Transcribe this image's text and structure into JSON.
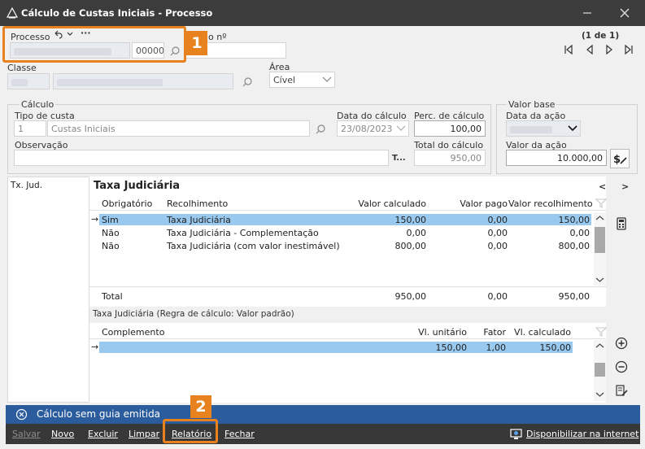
{
  "window": {
    "title": "Cálculo de Custas Iniciais - Processo"
  },
  "header": {
    "processo_label": "Processo",
    "processo_value": "00000",
    "calculo_no_label": "o nº",
    "pagination": "(1 de 1)",
    "classe_label": "Classe",
    "area_label": "Área",
    "area_value": "Cível"
  },
  "calculo": {
    "group_label": "Cálculo",
    "tipo_label": "Tipo de custa",
    "tipo_code": "1",
    "tipo_value": "Custas Iniciais",
    "data_label": "Data do cálculo",
    "data_value": "23/08/2023",
    "perc_label": "Perc. de cálculo",
    "perc_value": "100,00",
    "obs_label": "Observação",
    "obs_button": "T...",
    "total_label": "Total do cálculo",
    "total_value": "950,00"
  },
  "valor_base": {
    "group_label": "Valor base",
    "data_acao_label": "Data da ação",
    "valor_acao_label": "Valor da ação",
    "valor_acao_value": "10.000,00"
  },
  "left_list": {
    "items": [
      "Tx. Jud."
    ]
  },
  "grid1": {
    "title": "Taxa Judiciária",
    "nav_prev": "<",
    "nav_next": ">",
    "columns": [
      "Obrigatório",
      "Recolhimento",
      "Valor calculado",
      "Valor pago",
      "Valor recolhimento"
    ],
    "rows": [
      {
        "obrigatorio": "Sim",
        "recolhimento": "Taxa Judiciária",
        "calculado": "150,00",
        "pago": "0,00",
        "recolhido": "150,00"
      },
      {
        "obrigatorio": "Não",
        "recolhimento": "Taxa Judiciária - Complementação",
        "calculado": "0,00",
        "pago": "0,00",
        "recolhido": "0,00"
      },
      {
        "obrigatorio": "Não",
        "recolhimento": "Taxa Judiciária (com valor inestimável)",
        "calculado": "800,00",
        "pago": "0,00",
        "recolhido": "800,00"
      }
    ],
    "total_label": "Total",
    "total_calculado": "950,00",
    "total_pago": "0,00",
    "total_recolhido": "950,00",
    "row_indicator": "→"
  },
  "grid2": {
    "caption": "Taxa Judiciária (Regra de cálculo: Valor padrão)",
    "columns": [
      "Complemento",
      "Vl. unitário",
      "Fator",
      "Vl. calculado"
    ],
    "rows": [
      {
        "complemento": "",
        "unitario": "150,00",
        "fator": "1,00",
        "calculado": "150,00"
      }
    ],
    "row_indicator": "→"
  },
  "status": {
    "message": "Cálculo sem guia emitida"
  },
  "toolbar": {
    "salvar": "Salvar",
    "novo": "Novo",
    "excluir": "Excluir",
    "limpar": "Limpar",
    "relatorio": "Relatório",
    "fechar": "Fechar",
    "disponibilizar": "Disponibilizar na internet"
  },
  "callouts": {
    "one": "1",
    "two": "2"
  },
  "colors": {
    "titlebar": "#3c3c3c",
    "status": "#2b5c9e",
    "callout": "#e8821e",
    "selection": "#99c9ee"
  }
}
